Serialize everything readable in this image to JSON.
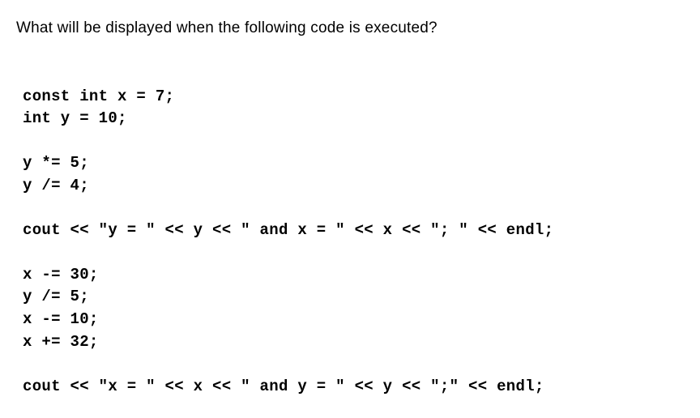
{
  "question": "What will be displayed when the following code is executed?",
  "code": {
    "line1": "const int x = 7;",
    "line2": "int y = 10;",
    "blank1": "",
    "line3": "y *= 5;",
    "line4": "y /= 4;",
    "blank2": "",
    "line5": "cout << \"y = \" << y << \" and x = \" << x << \"; \" << endl;",
    "blank3": "",
    "line6": "x -= 30;",
    "line7": "y /= 5;",
    "line8": "x -= 10;",
    "line9": "x += 32;",
    "blank4": "",
    "line10": "cout << \"x = \" << x << \" and y = \" << y << \";\" << endl;"
  }
}
